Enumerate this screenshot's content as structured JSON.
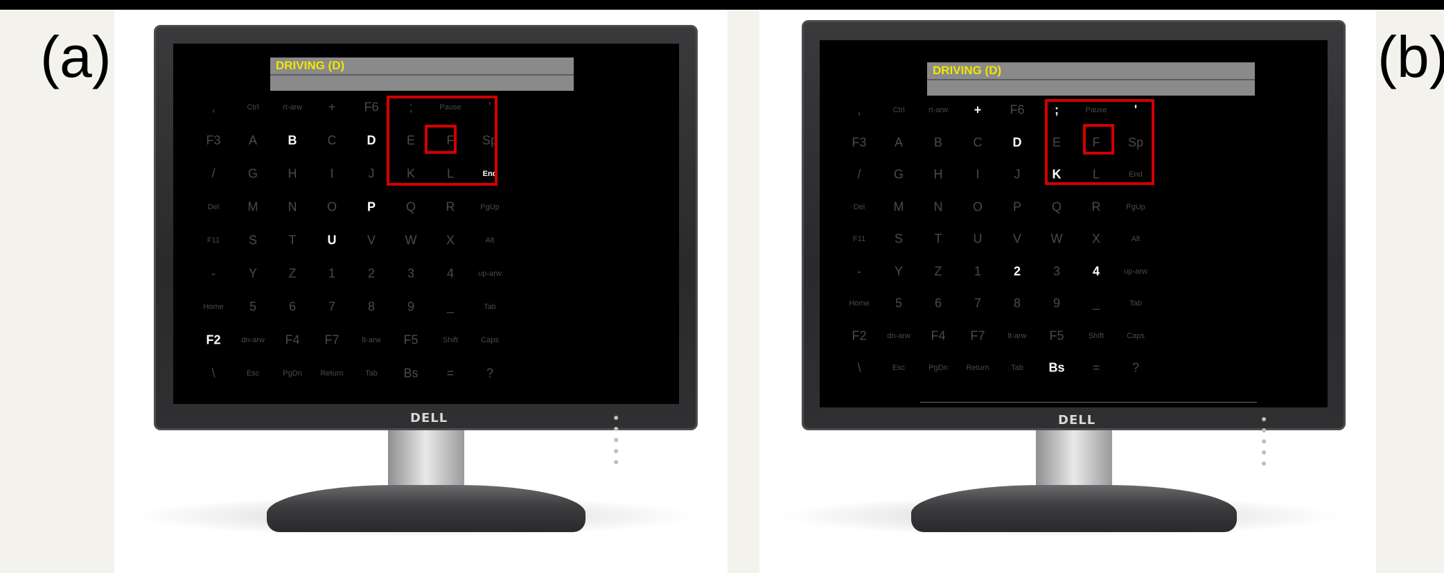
{
  "labels": {
    "a": "(a)",
    "b": "(b)"
  },
  "brand": "DELL",
  "title": "DRIVING (D)",
  "colors": {
    "title": "#f2e600",
    "dim": "#4a4a4a",
    "lit": "#ffffff",
    "highlight": "#d30000"
  },
  "grid": [
    [
      ",",
      "Ctrl",
      "rt-arw",
      "+",
      "F6",
      ";",
      "Pause",
      "'"
    ],
    [
      "F3",
      "A",
      "B",
      "C",
      "D",
      "E",
      "F",
      "Sp"
    ],
    [
      "/",
      "G",
      "H",
      "I",
      "J",
      "K",
      "L",
      "End"
    ],
    [
      "Del",
      "M",
      "N",
      "O",
      "P",
      "Q",
      "R",
      "PgUp"
    ],
    [
      "F11",
      "S",
      "T",
      "U",
      "V",
      "W",
      "X",
      "Alt"
    ],
    [
      "-",
      "Y",
      "Z",
      "1",
      "2",
      "3",
      "4",
      "up-arw"
    ],
    [
      "Home",
      "5",
      "6",
      "7",
      "8",
      "9",
      "_",
      "Tab"
    ],
    [
      "F2",
      "dn-arw",
      "F4",
      "F7",
      "lt-arw",
      "F5",
      "Shift",
      "Caps"
    ],
    [
      "\\",
      "Esc",
      "PgDn",
      "Return",
      "Tab",
      "Bs",
      "=",
      "?"
    ]
  ],
  "panels": [
    {
      "id": "a",
      "lit": [
        "B",
        "D",
        "End",
        "P",
        "U",
        "F2"
      ]
    },
    {
      "id": "b",
      "lit": [
        "+",
        ";",
        "'",
        "D",
        "K",
        "2",
        "4",
        "Bs"
      ]
    }
  ]
}
